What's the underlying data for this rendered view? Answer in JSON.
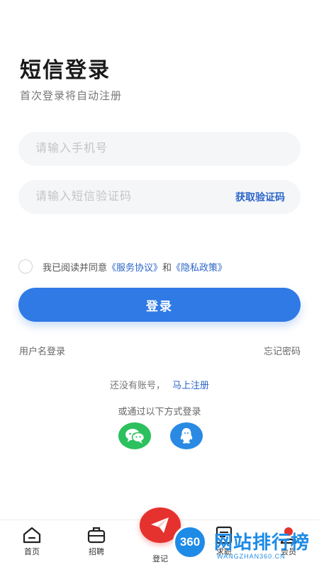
{
  "header": {
    "title": "短信登录",
    "subtitle": "首次登录将自动注册"
  },
  "form": {
    "phone_placeholder": "请输入手机号",
    "code_placeholder": "请输入短信验证码",
    "get_code_label": "获取验证码"
  },
  "agreement": {
    "text": "我已阅读并同意",
    "service_link": "《服务协议》",
    "and": "和",
    "privacy_link": "《隐私政策》"
  },
  "login_button_label": "登录",
  "links": {
    "username_login": "用户名登录",
    "forgot_password": "忘记密码"
  },
  "register": {
    "prompt": "还没有账号，",
    "link": "马上注册"
  },
  "other_login": {
    "label": "或通过以下方式登录",
    "icons": [
      "wechat-icon",
      "qq-icon"
    ]
  },
  "tabbar": {
    "items": [
      {
        "label": "首页",
        "icon": "home-icon"
      },
      {
        "label": "招聘",
        "icon": "briefcase-icon"
      },
      {
        "label": "登记",
        "icon": "paper-plane-icon"
      },
      {
        "label": "求职",
        "icon": "resume-icon"
      },
      {
        "label": "会员",
        "icon": "member-icon"
      }
    ]
  },
  "watermark": {
    "badge": "360",
    "text": "网站排行榜",
    "url": "WANGZHAN360.CN"
  },
  "colors": {
    "primary": "#2f7ae5",
    "link": "#2a64c8",
    "wechat": "#2cc05e",
    "qq": "#2a8ae3",
    "fab": "#e5322e"
  }
}
